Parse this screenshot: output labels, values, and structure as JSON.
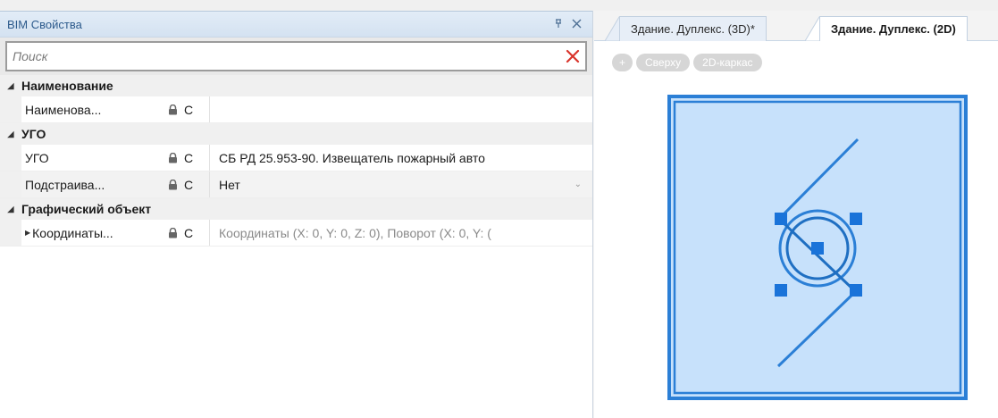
{
  "panel": {
    "title": "BIM Свойства",
    "pin_glyph": "⊥",
    "close_glyph": "✕",
    "search": {
      "placeholder": "Поиск",
      "value": ""
    }
  },
  "groups": [
    {
      "label": "Наименование",
      "rows": [
        {
          "name": "Наименова...",
          "lock": "lock-icon",
          "c": "С",
          "value": "",
          "style": "plain"
        }
      ]
    },
    {
      "label": "УГО",
      "rows": [
        {
          "name": "УГО",
          "lock": "lock-icon",
          "c": "С",
          "value": "СБ РД 25.953-90. Извещатель пожарный авто",
          "style": "plain"
        },
        {
          "name": "Подстраива...",
          "lock": "lock-icon",
          "c": "С",
          "value": "Нет",
          "style": "select"
        }
      ]
    },
    {
      "label": "Графический объект",
      "rows": [
        {
          "name": "Координаты...",
          "lock": "lock-icon",
          "c": "С",
          "value": "Координаты (X: 0, Y: 0, Z: 0), Поворот (X: 0, Y: (",
          "style": "muted"
        }
      ]
    }
  ],
  "tabs": [
    {
      "label": "Здание. Дуплекс. (3D)*",
      "active": false
    },
    {
      "label": "Здание. Дуплекс. (2D)",
      "active": true
    }
  ],
  "toolbar": {
    "plus": "+",
    "view": "Сверху",
    "mode": "2D-каркас"
  },
  "colors": {
    "accent": "#2b7fd6",
    "fill": "#c7e1fb",
    "handle": "#1a73d9",
    "clear": "#d9342b"
  }
}
